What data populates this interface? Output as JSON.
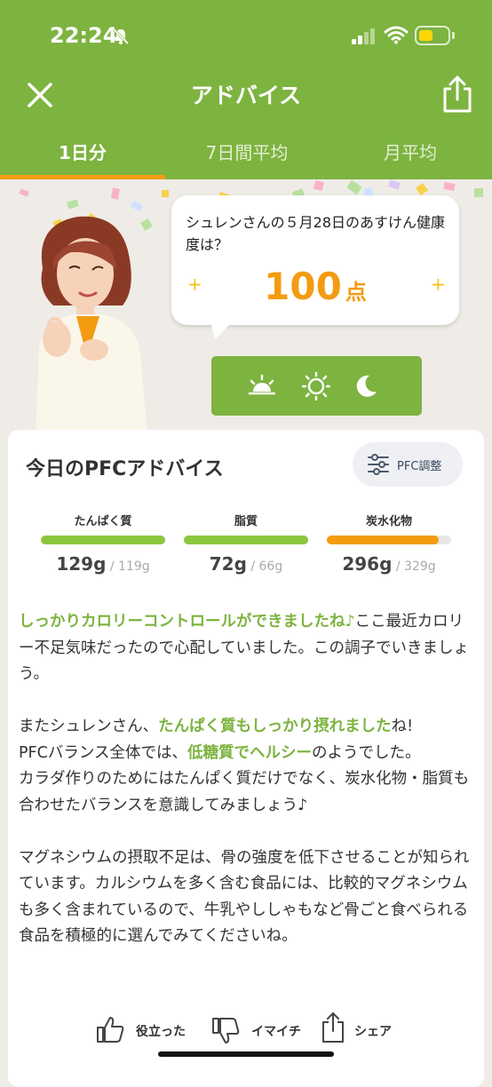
{
  "status_bar": {
    "time": "22:24"
  },
  "header": {
    "title": "アドバイス",
    "icons": {
      "close": "close-icon",
      "share": "share-icon"
    },
    "tabs": [
      {
        "label": "1日分",
        "active": true
      },
      {
        "label": "7日間平均",
        "active": false
      },
      {
        "label": "月平均",
        "active": false
      }
    ]
  },
  "score_bubble": {
    "message": "シュレンさんの５月28日のあすけん健康度は？",
    "score": "100",
    "unit": "点"
  },
  "time_of_day_icons": [
    "sunrise-icon",
    "sun-icon",
    "moon-icon"
  ],
  "pfc": {
    "title": "今日のPFCアドバイス",
    "settings_label": "PFC調整",
    "items": [
      {
        "name": "たんぱく質",
        "value": "129g",
        "target": " / 119g",
        "fill": 1.0,
        "color": "#8cc63f"
      },
      {
        "name": "脂質",
        "value": "72g",
        "target": " / 66g",
        "fill": 1.0,
        "color": "#8cc63f"
      },
      {
        "name": "炭水化物",
        "value": "296g",
        "target": " / 329g",
        "fill": 0.9,
        "color": "#f39c12"
      }
    ]
  },
  "advice": {
    "p1_highlight": "しっかりカロリーコントロールができましたね♪",
    "p1_rest": "ここ最近カロリー不足気味だったので心配していました。この調子でいきましょう。",
    "p2_a": "またシュレンさん、",
    "p2_highlight1": "たんぱく質もしっかり摂れました",
    "p2_b": "ね!",
    "p3_a": "PFCバランス全体では、",
    "p3_highlight": "低糖質でヘルシー",
    "p3_b": "のようでした。",
    "p4": "カラダ作りのためにはたんぱく質だけでなく、炭水化物・脂質も合わせたバランスを意識してみましょう♪",
    "p5": "マグネシウムの摂取不足は、骨の強度を低下させることが知られています。カルシウムを多く含む食品には、比較的マグネシウムも多く含まれているので、牛乳やししゃもなど骨ごと食べられる食品を積極的に選んでみてくださいね。"
  },
  "feedback": {
    "helpful": "役立った",
    "not_good": "イマイチ",
    "share": "シェア"
  },
  "colors": {
    "brand_green": "#7db33f",
    "accent_orange": "#f39c12"
  }
}
